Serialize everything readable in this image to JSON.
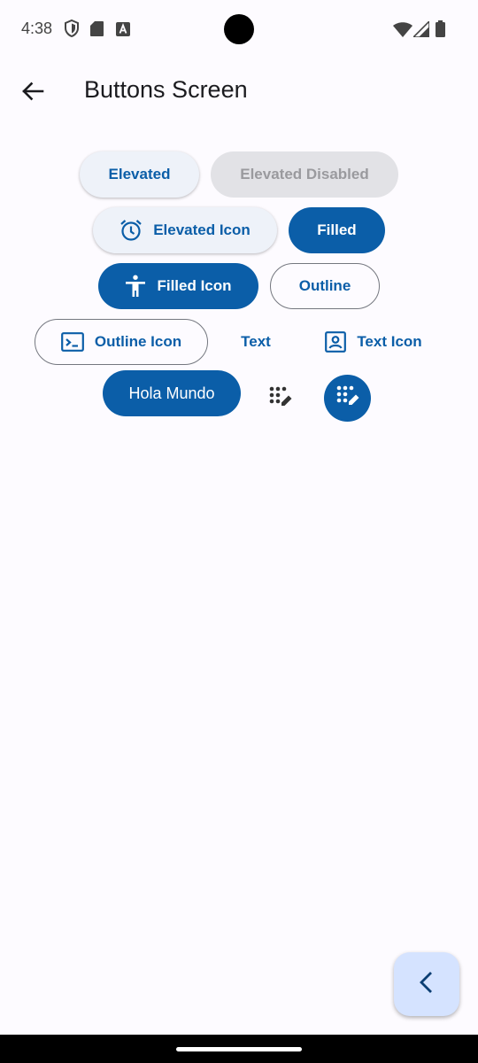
{
  "status_bar": {
    "time": "4:38",
    "left_icons": [
      "shield-icon",
      "sd-card-icon",
      "a-box-icon"
    ],
    "right_icons": [
      "wifi-icon",
      "signal-icon",
      "battery-icon"
    ]
  },
  "app_bar": {
    "title": "Buttons Screen",
    "back_icon": "arrow-back-icon"
  },
  "buttons": {
    "elevated": "Elevated",
    "elevated_disabled": "Elevated Disabled",
    "elevated_icon": "Elevated Icon",
    "filled": "Filled",
    "filled_icon": "Filled Icon",
    "outline": "Outline",
    "outline_icon": "Outline Icon",
    "text": "Text",
    "text_icon": "Text Icon",
    "hola": "Hola Mundo"
  },
  "icons": {
    "elevated_icon": "alarm-icon",
    "filled_icon": "accessibility-icon",
    "outline_icon": "terminal-icon",
    "text_icon": "portrait-icon",
    "icon_button": "dialpad-edit-icon",
    "fab": "chevron-left-icon"
  },
  "colors": {
    "primary": "#0b5ea8",
    "elevated_bg": "#eef2f9",
    "disabled_bg": "#e2e2e6",
    "disabled_text": "#9a9a9e",
    "fab_bg": "#d5e3ff",
    "background": "#fdfbff"
  }
}
